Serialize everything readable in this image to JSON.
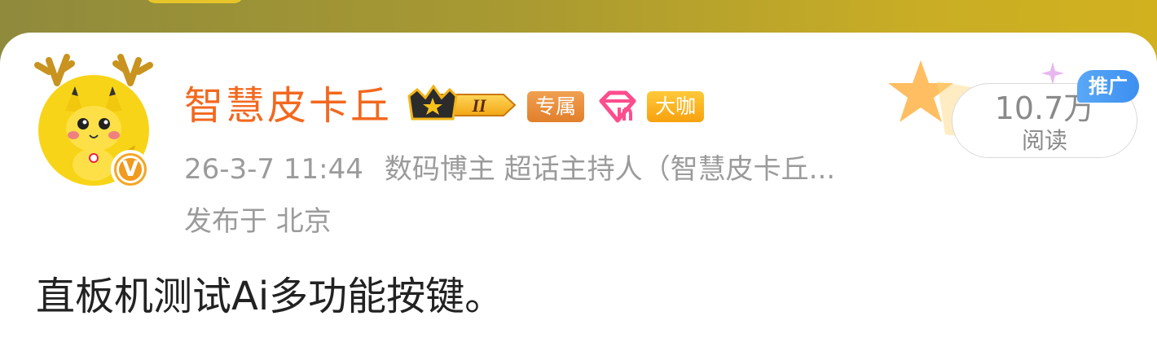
{
  "user": {
    "name": "智慧皮卡丘",
    "level_roman": "II",
    "tags": {
      "exclusive": "专属",
      "vip": "大咖"
    },
    "verified_mark": "V"
  },
  "post": {
    "meta": "26-3-7 11:44  数码博主 超话主持人（智慧皮卡丘...",
    "time": "26-3-7 11:44",
    "identity": "数码博主 超话主持人（智慧皮卡丘...",
    "location": "发布于 北京",
    "content": "直板机测试Ai多功能按键。"
  },
  "stats": {
    "reads": "10.7万",
    "reads_label": "阅读"
  },
  "promo_label": "推广",
  "colors": {
    "username": "#f3681e",
    "meta_text": "#9b9b9b",
    "promo_bg": "#3c8ff0",
    "header_bg": "#b8a02c"
  },
  "icons": [
    "pikachu-avatar",
    "verified-v-icon",
    "crown-level-badge",
    "gem-icon",
    "star-decoration",
    "sparkle-icon"
  ]
}
